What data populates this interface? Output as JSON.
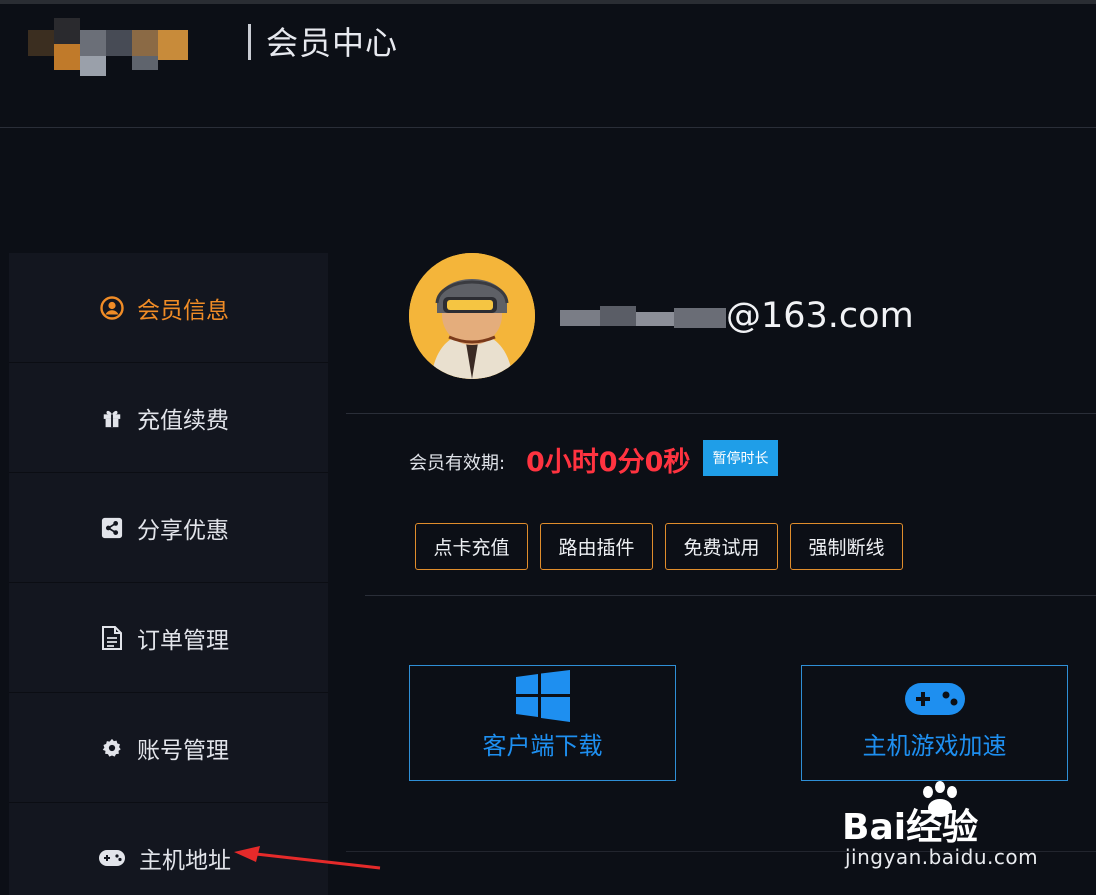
{
  "header": {
    "title": "会员中心"
  },
  "sidebar": {
    "items": [
      {
        "label": "会员信息",
        "icon": "user-circle-icon",
        "active": true
      },
      {
        "label": "充值续费",
        "icon": "gift-icon",
        "active": false
      },
      {
        "label": "分享优惠",
        "icon": "share-icon",
        "active": false
      },
      {
        "label": "订单管理",
        "icon": "document-icon",
        "active": false
      },
      {
        "label": "账号管理",
        "icon": "gear-icon",
        "active": false
      },
      {
        "label": "主机地址",
        "icon": "gamepad-icon",
        "active": false
      }
    ]
  },
  "profile": {
    "email_suffix": "@163.com"
  },
  "membership": {
    "validity_label": "会员有效期:",
    "validity_value": "0小时0分0秒",
    "pause_label": "暂停时长"
  },
  "actions": [
    {
      "label": "点卡充值"
    },
    {
      "label": "路由插件"
    },
    {
      "label": "免费试用"
    },
    {
      "label": "强制断线"
    }
  ],
  "cards": [
    {
      "label": "客户端下载",
      "icon": "windows-icon"
    },
    {
      "label": "主机游戏加速",
      "icon": "gamepad-icon"
    }
  ],
  "watermark": {
    "brand": "Bai经验",
    "domain": "jingyan.baidu.com"
  },
  "colors": {
    "accent_orange": "#f08c26",
    "timer_red": "#ff3340",
    "button_blue": "#1f9ee8",
    "link_blue": "#1e8ff0"
  }
}
